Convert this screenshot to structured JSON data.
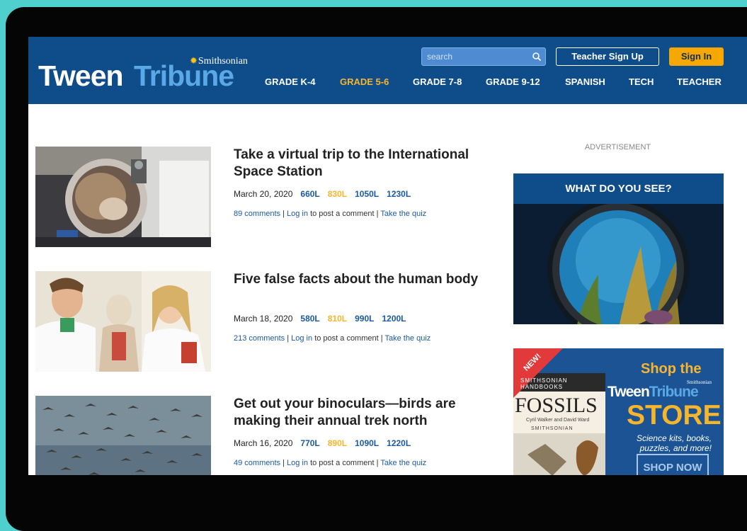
{
  "header": {
    "logo": {
      "smithsonian": "Smithsonian",
      "tween": "Tween",
      "tribune": "Tribune"
    },
    "search_placeholder": "search",
    "teacher_signup": "Teacher Sign Up",
    "sign_in": "Sign In",
    "nav": [
      {
        "label": "GRADE K-4",
        "active": false
      },
      {
        "label": "GRADE 5-6",
        "active": true
      },
      {
        "label": "GRADE 7-8",
        "active": false
      },
      {
        "label": "GRADE 9-12",
        "active": false
      },
      {
        "label": "SPANISH",
        "active": false
      },
      {
        "label": "TECH",
        "active": false
      },
      {
        "label": "TEACHER",
        "active": false
      }
    ]
  },
  "articles": [
    {
      "title": "Take a virtual trip to the International Space Station",
      "date": "March 20, 2020",
      "lexiles": [
        "660L",
        "830L",
        "1050L",
        "1230L"
      ],
      "highlight": 1,
      "comments": "89 comments",
      "login": "Log in",
      "post_text": "to post a comment",
      "quiz": "Take the quiz"
    },
    {
      "title": "Five false facts about the human body",
      "date": "March 18, 2020",
      "lexiles": [
        "580L",
        "810L",
        "990L",
        "1200L"
      ],
      "highlight": 1,
      "comments": "213 comments",
      "login": "Log in",
      "post_text": "to post a comment",
      "quiz": "Take the quiz"
    },
    {
      "title": "Get out your binoculars—birds are making their annual trek north",
      "date": "March 16, 2020",
      "lexiles": [
        "770L",
        "890L",
        "1090L",
        "1220L"
      ],
      "highlight": 1,
      "comments": "49 comments",
      "login": "Log in",
      "post_text": "to post a comment",
      "quiz": "Take the quiz"
    }
  ],
  "sidebar": {
    "advertisement": "ADVERTISEMENT",
    "what_do_you_see": "WHAT DO YOU SEE?",
    "store": {
      "new_badge": "NEW!",
      "book_series": "SMITHSONIAN HANDBOOKS",
      "book_title": "FOSSILS",
      "book_authors": "Cyril Walker and David Ward",
      "book_publisher": "SMITHSONIAN",
      "shop_the": "Shop the",
      "brand_small": "Smithsonian",
      "brand_tween": "Tween",
      "brand_tribune": "Tribune",
      "store_word": "STORE",
      "tagline": "Science kits, books, puzzles, and more!",
      "shop_now": "SHOP NOW"
    }
  },
  "colors": {
    "header_blue": "#0f4c8a",
    "accent_orange": "#f7a800",
    "link_blue": "#1a5aa3",
    "highlight_yellow": "#f7b52c",
    "frame_teal": "#4fd0cf"
  }
}
